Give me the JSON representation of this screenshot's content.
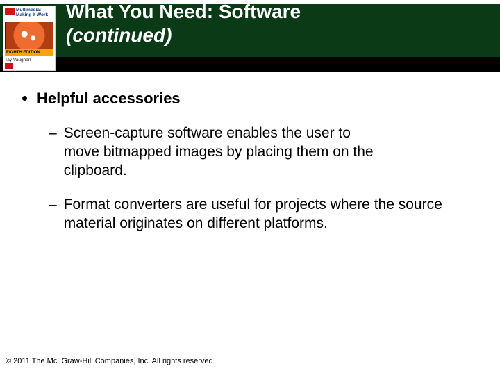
{
  "header": {
    "title_main": "What You Need: Software",
    "title_continued": "(continued)"
  },
  "book_cover": {
    "line1": "Multimedia:",
    "line2": "Making It Work",
    "edition": "EIGHTH EDITION",
    "author": "Tay Vaughan"
  },
  "body": {
    "bullet": "Helpful accessories",
    "subbullets": [
      "Screen-capture software enables the user to move bitmapped images by placing them on the clipboard.",
      "Format converters are useful for projects where the source material originates on different platforms."
    ]
  },
  "footer": {
    "copyright": "© 2011 The Mc. Graw-Hill Companies, Inc. All rights reserved"
  }
}
